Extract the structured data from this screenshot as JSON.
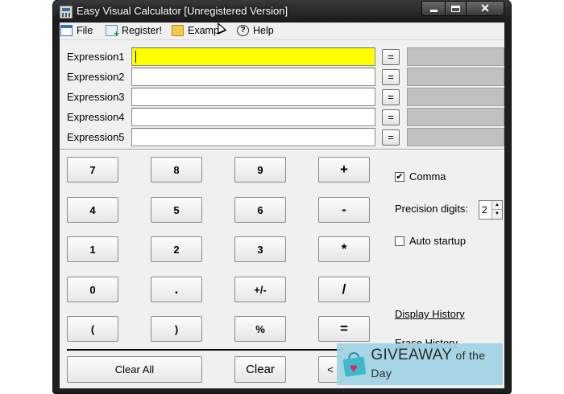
{
  "window": {
    "title": "Easy Visual Calculator [Unregistered Version]",
    "controls": {
      "minimize": "minimize",
      "maximize": "maximize",
      "close": "✕"
    }
  },
  "menu": [
    {
      "label": "File",
      "icon": "file-icon"
    },
    {
      "label": "Register!",
      "icon": "register-icon"
    },
    {
      "label": "Examp",
      "icon": "examples-icon"
    },
    {
      "label": "Help",
      "icon": "help-icon"
    }
  ],
  "expressions": [
    {
      "label": "Expression1",
      "value": "",
      "result": "",
      "active": true
    },
    {
      "label": "Expression2",
      "value": "",
      "result": ""
    },
    {
      "label": "Expression3",
      "value": "",
      "result": ""
    },
    {
      "label": "Expression4",
      "value": "",
      "result": ""
    },
    {
      "label": "Expression5",
      "value": "",
      "result": ""
    }
  ],
  "eq_label": "=",
  "keypad": [
    [
      "7",
      "8",
      "9",
      "+"
    ],
    [
      "4",
      "5",
      "6",
      "-"
    ],
    [
      "1",
      "2",
      "3",
      "*"
    ],
    [
      "0",
      ".",
      "+/-",
      "/"
    ],
    [
      "(",
      ")",
      "%",
      "="
    ]
  ],
  "bottom_buttons": {
    "clear_all": "Clear All",
    "clear": "Clear",
    "back": "<"
  },
  "options": {
    "comma": {
      "label": "Comma",
      "checked": true,
      "mark": "✔"
    },
    "precision_label": "Precision digits:",
    "precision_value": "2",
    "auto_startup": {
      "label": "Auto startup",
      "checked": false,
      "mark": ""
    }
  },
  "links": {
    "display_history": "Display History",
    "erase_history": "Erase History"
  },
  "watermark": {
    "brand": "GIVEAWAY",
    "suffix": " of the Day"
  },
  "colors": {
    "active_input": "#ffff00",
    "result_box": "#c0c0c0",
    "watermark_bg": "#a0d2e4"
  }
}
